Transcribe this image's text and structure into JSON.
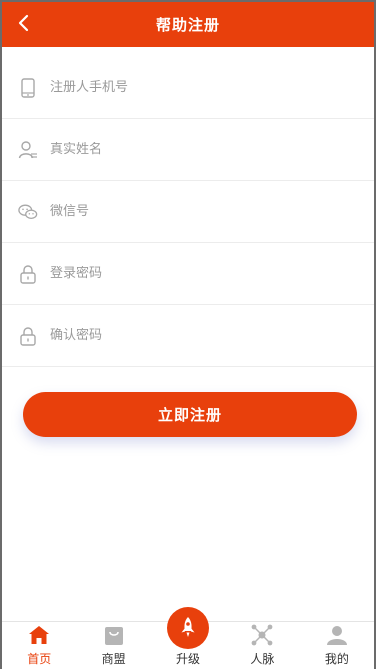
{
  "header": {
    "title": "帮助注册",
    "back_icon": "chevron-left-icon"
  },
  "form": {
    "fields": [
      {
        "icon": "phone-icon",
        "placeholder": "注册人手机号",
        "value": ""
      },
      {
        "icon": "user-icon",
        "placeholder": "真实姓名",
        "value": ""
      },
      {
        "icon": "wechat-icon",
        "placeholder": "微信号",
        "value": ""
      },
      {
        "icon": "lock-icon",
        "placeholder": "登录密码",
        "value": ""
      },
      {
        "icon": "lock-icon",
        "placeholder": "确认密码",
        "value": ""
      }
    ],
    "submit_label": "立即注册"
  },
  "tabbar": {
    "items": [
      {
        "label": "首页",
        "icon": "home-icon",
        "active": true
      },
      {
        "label": "商盟",
        "icon": "shop-bag-icon",
        "active": false
      },
      {
        "label": "升级",
        "icon": "rocket-icon",
        "active": false
      },
      {
        "label": "人脉",
        "icon": "network-icon",
        "active": false
      },
      {
        "label": "我的",
        "icon": "profile-icon",
        "active": false
      }
    ]
  },
  "colors": {
    "accent": "#e8400c",
    "placeholder": "#9a9a9a",
    "divider": "#ececec",
    "icon_gray": "#a8a8a8"
  }
}
